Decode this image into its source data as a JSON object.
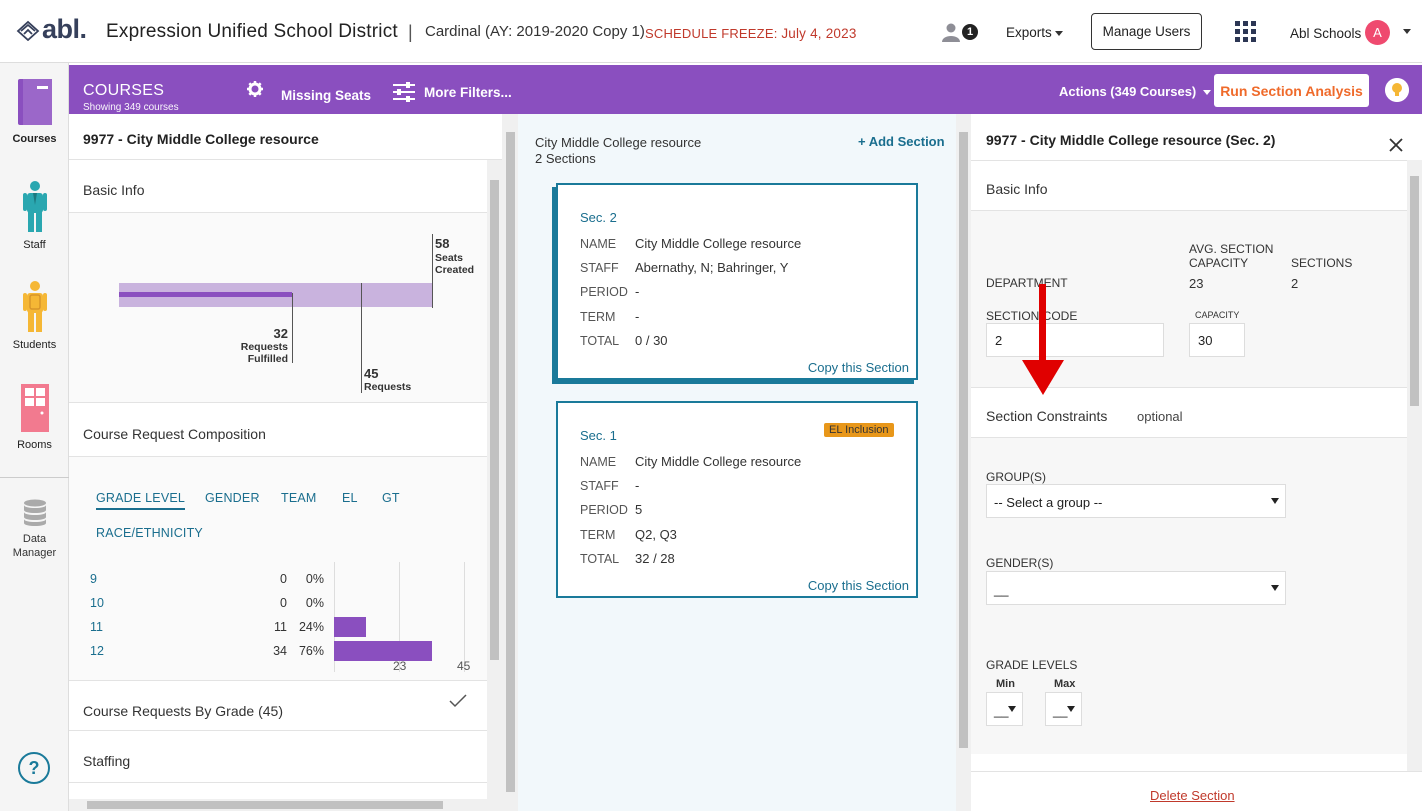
{
  "header": {
    "logo_text": "abl.",
    "district": "Expression Unified School District",
    "separator": "|",
    "cardinal": "Cardinal (AY: 2019-2020 Copy 1)",
    "freeze_label": "SCHEDULE FREEZE:",
    "freeze_date": "July 4, 2023",
    "notification_count": "1",
    "exports": "Exports",
    "manage_users": "Manage Users",
    "org_name": "Abl Schools",
    "avatar_letter": "A"
  },
  "leftnav": {
    "items": [
      {
        "label": "Courses",
        "icon": "courses-icon"
      },
      {
        "label": "Staff",
        "icon": "staff-icon"
      },
      {
        "label": "Students",
        "icon": "students-icon"
      },
      {
        "label": "Rooms",
        "icon": "rooms-icon"
      },
      {
        "label_line1": "Data",
        "label_line2": "Manager",
        "icon": "database-icon"
      }
    ],
    "help": "?"
  },
  "toolbar": {
    "title": "COURSES",
    "subtitle": "Showing 349 courses",
    "missing_seats": "Missing Seats",
    "more_filters": "More Filters...",
    "actions": "Actions (349 Courses)",
    "run_analysis": "Run Section Analysis"
  },
  "course_panel": {
    "title": "9977 - City Middle College resource",
    "basic_info": "Basic Info",
    "seats_created_value": "58",
    "seats_created_line1": "Seats",
    "seats_created_line2": "Created",
    "fulfilled_value": "32",
    "fulfilled_line1": "Requests",
    "fulfilled_line2": "Fulfilled",
    "requests_value": "45",
    "requests_label": "Requests",
    "composition_title": "Course Request Composition",
    "tabs": [
      "GRADE LEVEL",
      "GENDER",
      "TEAM",
      "EL",
      "GT",
      "RACE/ETHNICITY"
    ],
    "active_tab": "GRADE LEVEL",
    "grades": [
      {
        "grade": "9",
        "count": "0",
        "pct": "0%",
        "value": 0
      },
      {
        "grade": "10",
        "count": "0",
        "pct": "0%",
        "value": 0
      },
      {
        "grade": "11",
        "count": "11",
        "pct": "24%",
        "value": 11
      },
      {
        "grade": "12",
        "count": "34",
        "pct": "76%",
        "value": 34
      }
    ],
    "axis_max": 45,
    "axis_mid": 23,
    "axis_mid_label": "23",
    "axis_max_label": "45",
    "requests_by_grade": "Course Requests By Grade (45)",
    "staffing": "Staffing"
  },
  "sections_panel": {
    "title": "City Middle College resource",
    "count": "2 Sections",
    "add_section": "+ Add Section",
    "labels": {
      "name": "NAME",
      "staff": "STAFF",
      "period": "PERIOD",
      "term": "TERM",
      "total": "TOTAL"
    },
    "copy_label": "Copy this Section",
    "sections": [
      {
        "id": "Sec. 2",
        "name": "City Middle College resource",
        "staff": "Abernathy, N; Bahringer, Y",
        "period": "-",
        "term": "-",
        "total": "0 / 30",
        "badge": ""
      },
      {
        "id": "Sec. 1",
        "name": "City Middle College resource",
        "staff": "-",
        "period": "5",
        "term": "Q2, Q3",
        "total": "32 / 28",
        "badge": "EL Inclusion"
      }
    ]
  },
  "section_detail": {
    "title": "9977 - City Middle College resource (Sec. 2)",
    "basic_info": "Basic Info",
    "department_label": "DEPARTMENT",
    "avg_capacity_label_1": "AVG. SECTION",
    "avg_capacity_label_2": "CAPACITY",
    "avg_capacity_value": "23",
    "sections_label": "SECTIONS",
    "sections_value": "2",
    "section_code_label": "SECTION CODE",
    "section_code_value": "2",
    "capacity_label": "CAPACITY",
    "capacity_value": "30",
    "constraints_title": "Section Constraints",
    "constraints_optional": "optional",
    "groups_label": "GROUP(S)",
    "groups_value": "-- Select a group --",
    "gender_label": "GENDER(S)",
    "gender_value": "__",
    "grade_levels_label": "GRADE LEVELS",
    "min_label": "Min",
    "max_label": "Max",
    "min_value": "__",
    "max_value": "__",
    "delete_section": "Delete Section"
  },
  "colors": {
    "purple": "#8a4fbf",
    "teal": "#1a7a9a",
    "orange": "#ef6a2a",
    "red": "#e00000",
    "bar_light": "#c9b3de",
    "bar_dark": "#8a4fbf"
  }
}
